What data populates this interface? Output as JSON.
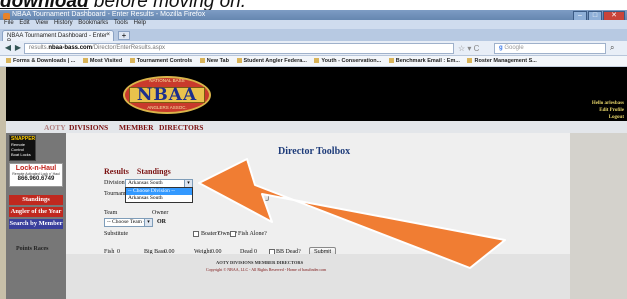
{
  "caption": {
    "bold_text": "download",
    "rest_text": " before moving on."
  },
  "window": {
    "title": "NBAA Tournament Dashboard - Enter Results - Mozilla Firefox",
    "minimize": "–",
    "maximize": "□",
    "close": "✕"
  },
  "menu": [
    "File",
    "Edit",
    "View",
    "History",
    "Bookmarks",
    "Tools",
    "Help"
  ],
  "tab": {
    "label": "NBAA Tournament Dashboard - Enter R...",
    "close": "×",
    "new_tab": "+"
  },
  "nav": {
    "back": "◀",
    "forward": "▶",
    "url_prefix": "results.",
    "url_host": "nbaa-bass.com",
    "url_path": "/Director/EnterResults.aspx",
    "search_engine": "Google",
    "star": "☆ ▾ C",
    "search_glyph": "⌕"
  },
  "bookmarks": [
    "Forms & Downloads | ...",
    "Most Visited",
    "Tournament Controls",
    "New Tab",
    "Student Angler Federa...",
    "Youth - Conservation...",
    "Benchmark Email : Em...",
    "Roster Management S..."
  ],
  "site": {
    "logo": {
      "top_text": "NATIONAL BASS",
      "letters": "NBAA",
      "bottom_text": "ANGLERS ASSOC."
    },
    "hello_lines": [
      "Hello arlesbass",
      "Edit Profile",
      "Logout"
    ],
    "nav": [
      "AOTY",
      "DIVISIONS",
      "MEMBER",
      "DIRECTORS"
    ],
    "sidebar": {
      "ad1_title": "SNAPPER",
      "ad1_lines": [
        "Remote",
        "Control",
        "Boat Locks"
      ],
      "ad2_title": "Lock-n-Haul",
      "ad2_sub": "Remote Activated Lock n' Haul",
      "ad2_phone": "866.960.6749",
      "buttons": [
        "Standings",
        "Angler of the Year",
        "Search by Member"
      ],
      "points_races": "Points Races"
    },
    "content": {
      "title": "Director Toolbox",
      "links": [
        "Results",
        "Standings"
      ],
      "division_label": "Division",
      "division_value": "Arkansas South",
      "dropdown_options": [
        "-- Choose Division --",
        "Arkansas South"
      ],
      "tournament_label": "Tournam",
      "remove_all": "Remove All",
      "team_label": "Team",
      "owner_label": "Owner",
      "team_placeholder": "-- Choose Team --",
      "or_text": "OR",
      "substitute_label": "Substitute",
      "boater_label": "Boater?",
      "owner_q_label": "Owner?",
      "fish_alone_label": "Fish Alone?",
      "fish_label": "Fish",
      "fish_value": "0",
      "big_bass_label": "Big Bass",
      "big_bass_value": "0.00",
      "weight_label": "Weight",
      "weight_value": "0.00",
      "dead_label": "Dead",
      "dead_value": "0",
      "bb_dead_label": "BB Dead?",
      "submit": "Submit"
    },
    "footer": {
      "links": "AOTY    DIVISIONS    MEMBER    DIRECTORS",
      "copyright": "Copyright © NBAA, LLC - All Rights Reserved - Home of bassfinder.com"
    }
  },
  "colors": {
    "arrow": "#f07d33",
    "nav_link": "#7a1010",
    "title_blue": "#1e3c7a",
    "button_red": "#c0281f",
    "button_blue": "#3a3f9c"
  }
}
